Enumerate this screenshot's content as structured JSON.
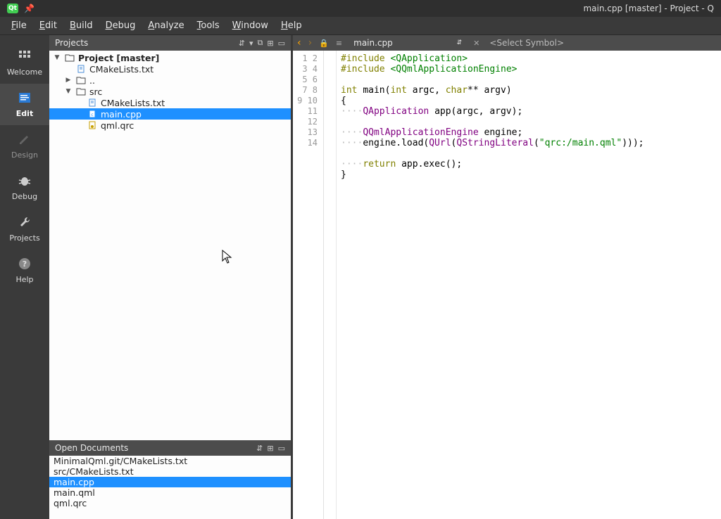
{
  "window": {
    "title": "main.cpp [master] - Project - Q"
  },
  "menu": {
    "items": [
      "File",
      "Edit",
      "Build",
      "Debug",
      "Analyze",
      "Tools",
      "Window",
      "Help"
    ]
  },
  "modes": [
    {
      "id": "welcome",
      "label": "Welcome"
    },
    {
      "id": "edit",
      "label": "Edit"
    },
    {
      "id": "design",
      "label": "Design"
    },
    {
      "id": "debug",
      "label": "Debug"
    },
    {
      "id": "projects",
      "label": "Projects"
    },
    {
      "id": "help",
      "label": "Help"
    }
  ],
  "projects_panel": {
    "title": "Projects"
  },
  "tree": {
    "project": "Project [master]",
    "cmake_root": "CMakeLists.txt",
    "dotdot": "..",
    "src": "src",
    "cmake_src": "CMakeLists.txt",
    "maincpp": "main.cpp",
    "qmlqrc": "qml.qrc"
  },
  "open_docs": {
    "title": "Open Documents",
    "items": [
      "MinimalQml.git/CMakeLists.txt",
      "src/CMakeLists.txt",
      "main.cpp",
      "main.qml",
      "qml.qrc"
    ]
  },
  "editor": {
    "current_file": "main.cpp",
    "symbol_placeholder": "<Select Symbol>",
    "line_count": 14
  },
  "code": {
    "l1_kw": "#include",
    "l1_inc": "<QApplication>",
    "l2_kw": "#include",
    "l2_inc": "<QQmlApplicationEngine>",
    "l4_int": "int",
    "l4_main": "main(",
    "l4_int2": "int",
    "l4_argc": "argc,",
    "l4_char": "char",
    "l4_rest": "** argv)",
    "l5": "{",
    "l6_type": "QApplication",
    "l6_rest": "app(argc, argv);",
    "l8_type": "QQmlApplicationEngine",
    "l8_rest": "engine;",
    "l9_a": "engine.load(",
    "l9_qurl": "QUrl",
    "l9_b": "(",
    "l9_qsl": "QStringLiteral",
    "l9_c": "(",
    "l9_str": "\"qrc:/main.qml\"",
    "l9_d": ")));",
    "l11_ret": "return",
    "l11_rest": "app.exec();",
    "l12": "}"
  }
}
